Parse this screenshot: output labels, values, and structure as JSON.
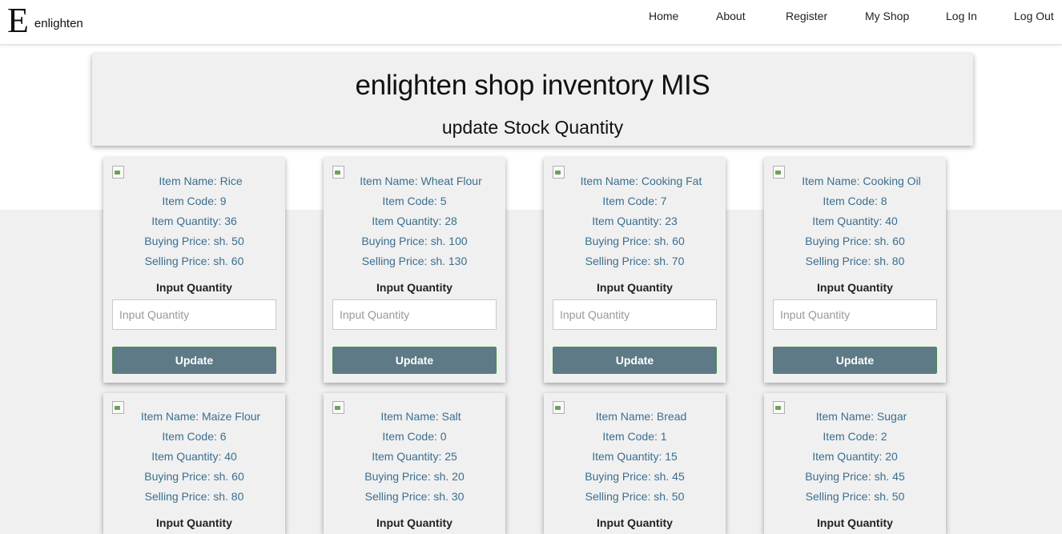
{
  "brand": {
    "logo_letter": "E",
    "name": "enlighten"
  },
  "nav": [
    {
      "label": "Home"
    },
    {
      "label": "About"
    },
    {
      "label": "Register"
    },
    {
      "label": "My Shop"
    },
    {
      "label": "Log In"
    },
    {
      "label": "Log Out"
    }
  ],
  "header": {
    "title": "enlighten shop inventory MIS",
    "subtitle": "update Stock Quantity"
  },
  "card_labels": {
    "input_label": "Input Quantity",
    "input_placeholder": "Input Quantity",
    "button_label": "Update"
  },
  "items": [
    {
      "name": "Item Name: Rice",
      "code": "Item Code: 9",
      "quantity": "Item Quantity: 36",
      "buying": "Buying Price: sh. 50",
      "selling": "Selling Price: sh. 60"
    },
    {
      "name": "Item Name: Wheat Flour",
      "code": "Item Code: 5",
      "quantity": "Item Quantity: 28",
      "buying": "Buying Price: sh. 100",
      "selling": "Selling Price: sh. 130"
    },
    {
      "name": "Item Name: Cooking Fat",
      "code": "Item Code: 7",
      "quantity": "Item Quantity: 23",
      "buying": "Buying Price: sh. 60",
      "selling": "Selling Price: sh. 70"
    },
    {
      "name": "Item Name: Cooking Oil",
      "code": "Item Code: 8",
      "quantity": "Item Quantity: 40",
      "buying": "Buying Price: sh. 60",
      "selling": "Selling Price: sh. 80"
    },
    {
      "name": "Item Name: Maize Flour",
      "code": "Item Code: 6",
      "quantity": "Item Quantity: 40",
      "buying": "Buying Price: sh. 60",
      "selling": "Selling Price: sh. 80"
    },
    {
      "name": "Item Name: Salt",
      "code": "Item Code: 0",
      "quantity": "Item Quantity: 25",
      "buying": "Buying Price: sh. 20",
      "selling": "Selling Price: sh. 30"
    },
    {
      "name": "Item Name: Bread",
      "code": "Item Code: 1",
      "quantity": "Item Quantity: 15",
      "buying": "Buying Price: sh. 45",
      "selling": "Selling Price: sh. 50"
    },
    {
      "name": "Item Name: Sugar",
      "code": "Item Code: 2",
      "quantity": "Item Quantity: 20",
      "buying": "Buying Price: sh. 45",
      "selling": "Selling Price: sh. 50"
    }
  ],
  "colors": {
    "page_gray": "#f0f0f0",
    "item_text": "#3a6e8f",
    "button_bg": "#5e7a87",
    "button_border": "#4a8e4e"
  }
}
